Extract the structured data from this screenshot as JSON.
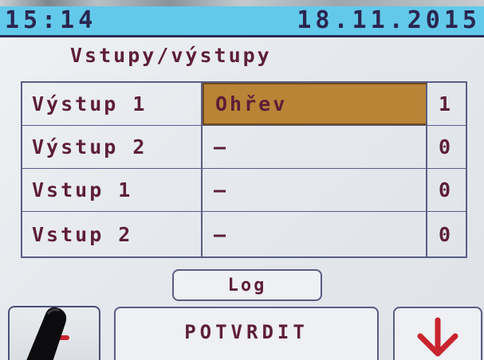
{
  "status": {
    "time": "15:14",
    "date": "18.11.2015"
  },
  "screen": {
    "title": "Vstupy/výstupy"
  },
  "io_rows": [
    {
      "name": "Výstup 1",
      "function": "Ohřev",
      "state": "1"
    },
    {
      "name": "Výstup 2",
      "function": "–",
      "state": "0"
    },
    {
      "name": "Vstup 1",
      "function": "–",
      "state": "0"
    },
    {
      "name": "Vstup 2",
      "function": "–",
      "state": "0"
    }
  ],
  "buttons": {
    "log_label": "Log",
    "confirm_label": "POTVRDIT",
    "back_icon": "back-arrow-icon",
    "down_icon": "down-arrow-icon"
  },
  "colors": {
    "status_bar": "#62c9ea",
    "text": "#5d1e38",
    "selected_cell": "#b98436",
    "border": "#5a5d85",
    "arrow_red": "#c8242e"
  }
}
